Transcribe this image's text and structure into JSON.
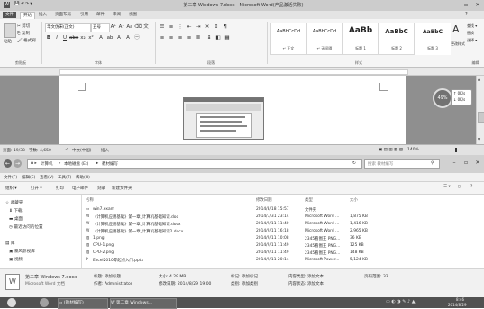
{
  "word": {
    "title": "第二章 Windows 7.docx - Microsoft Word(产品激活失败)",
    "tabs": [
      "文件",
      "开始",
      "插入",
      "页面布局",
      "引用",
      "邮件",
      "审阅",
      "视图"
    ],
    "clipboard": {
      "paste": "粘贴",
      "cut": "剪切",
      "copy": "复制",
      "painter": "格式刷",
      "label": "剪贴板"
    },
    "font": {
      "name": "华文仿宋(正文)",
      "size": "五号",
      "label": "字体"
    },
    "paragraph_label": "段落",
    "styles": [
      {
        "preview": "AaBbCcDd",
        "name": "↵ 正文"
      },
      {
        "preview": "AaBbCcDd",
        "name": "↵ 无间隔"
      },
      {
        "preview": "AaBb",
        "name": "标题 1"
      },
      {
        "preview": "AaBbC",
        "name": "标题 2"
      },
      {
        "preview": "AaBbC",
        "name": "标题 3"
      }
    ],
    "styles_label": "样式",
    "change_styles": "更改样式",
    "editing": {
      "find": "查找 ▾",
      "replace": "替换",
      "select": "选择 ▾",
      "label": "编辑"
    },
    "status": {
      "page": "页面: 19/33",
      "words": "字数: 4,650",
      "lang": "中文(中国)",
      "mode": "插入",
      "zoom": "140%"
    },
    "zoom_badge": "49%",
    "net_up": "0K/s",
    "net_down": "0K/s"
  },
  "explorer": {
    "breadcrumb": [
      "计算机",
      "本地磁盘 (E:)",
      "教材编写"
    ],
    "search_placeholder": "搜索 教材编写",
    "menu": [
      "文件(F)",
      "编辑(E)",
      "查看(V)",
      "工具(T)",
      "帮助(H)"
    ],
    "toolbar": [
      "组织 ▾",
      "打开 ▾",
      "打印",
      "电子邮件",
      "刻录",
      "新建文件夹"
    ],
    "nav": [
      {
        "icon": "star-icon",
        "label": "收藏夹"
      },
      {
        "icon": "download-icon",
        "label": "下载"
      },
      {
        "icon": "desktop-icon",
        "label": "桌面"
      },
      {
        "icon": "recent-icon",
        "label": "最近访问的位置"
      },
      {
        "icon": "library-icon",
        "label": "库"
      },
      {
        "icon": "video-icon",
        "label": "暴风影视库"
      },
      {
        "icon": "video-icon",
        "label": "视频"
      }
    ],
    "columns": [
      "名称",
      "修改日期",
      "类型",
      "大小"
    ],
    "files": [
      {
        "name": "win7.exam",
        "date": "2014/8/18 15:57",
        "type": "文件夹",
        "size": ""
      },
      {
        "name": "《计算机应用基础》第一章_计算机基础知识.doc",
        "date": "2014/7/31 23:14",
        "type": "Microsoft Word ...",
        "size": "1,875 KB"
      },
      {
        "name": "《计算机应用基础》第一章_计算机基础知识.docx",
        "date": "2014/9/11 11:40",
        "type": "Microsoft Word ...",
        "size": "1,416 KB"
      },
      {
        "name": "《计算机应用基础》第一章_计算机基础知识2.docx",
        "date": "2014/9/11 16:18",
        "type": "Microsoft Word ...",
        "size": "2,965 KB"
      },
      {
        "name": "1.png",
        "date": "2014/9/11 10:08",
        "type": "2345看图王 PNG...",
        "size": "36 KB"
      },
      {
        "name": "CPU-1.png",
        "date": "2014/9/11 11:49",
        "type": "2345看图王 PNG...",
        "size": "125 KB"
      },
      {
        "name": "CPU-2.png",
        "date": "2014/9/11 11:49",
        "type": "2345看图王 PNG...",
        "size": "148 KB"
      },
      {
        "name": "Excel2010零起点入门.pptx",
        "date": "2014/9/11 20:14",
        "type": "Microsoft Power...",
        "size": "5,124 KB"
      }
    ],
    "details": {
      "filename": "第二章 Windows 7.docx",
      "kind": "Microsoft Word 文档",
      "title_label": "标题: 添加标题",
      "author_label": "作者: Administrator",
      "size_label": "大小: 4.29 MB",
      "modified_label": "修改日期: 2014/8/29 19:00",
      "tags_label": "标记: 添加标记",
      "category_label": "类别: 添加类别",
      "content_type": "内容类型: 添加文本",
      "status_label": "内容状态: 添加文本",
      "pages": "页码范围: 33"
    }
  },
  "taskbar": {
    "items": [
      "(教材编写)",
      "第二章 Windows..."
    ],
    "time": "8:46",
    "date": "2014/8/29"
  }
}
